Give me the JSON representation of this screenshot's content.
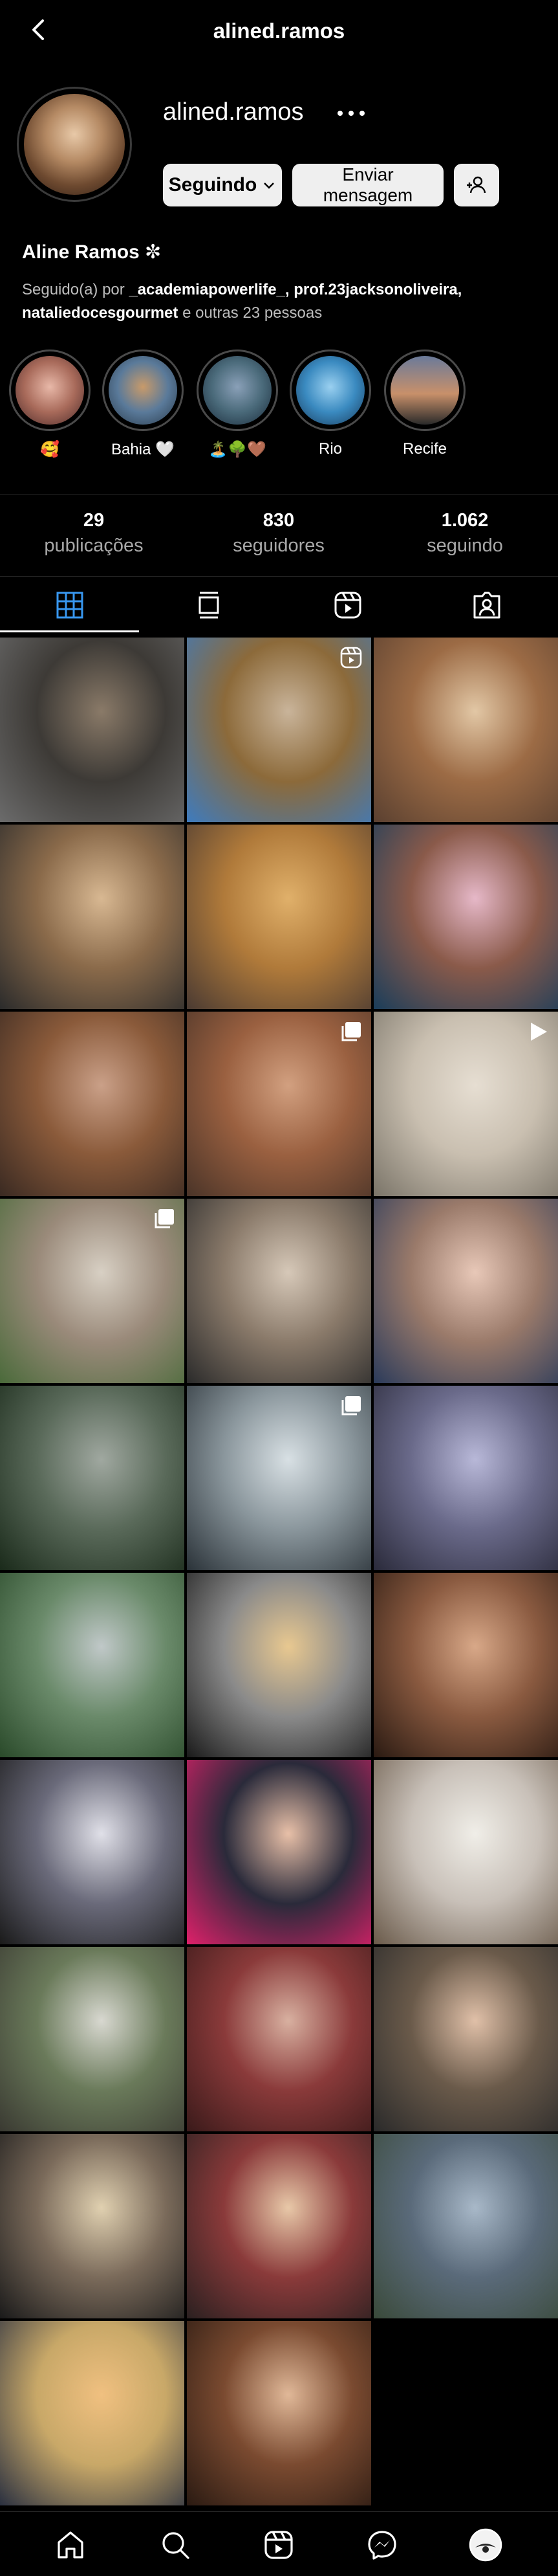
{
  "header": {
    "title": "alined.ramos"
  },
  "profile": {
    "username": "alined.ramos",
    "full_name": "Aline Ramos ✼",
    "follow_button": "Seguindo",
    "message_button_line1": "Enviar",
    "message_button_line2": "mensagem",
    "followed_by_prefix": "Seguido(a) por ",
    "followed_by_names": "_academiapowerlife_, prof.23jacksonoliveira, nataliedocesgourmet",
    "followed_by_suffix": " e outras 23 pessoas"
  },
  "highlights": [
    {
      "label": "🥰"
    },
    {
      "label": "Bahia 🤍"
    },
    {
      "label": "🏝️🌳🤎"
    },
    {
      "label": "Rio"
    },
    {
      "label": "Recife"
    }
  ],
  "stats": [
    {
      "number": "29",
      "label": "publicações"
    },
    {
      "number": "830",
      "label": "seguidores"
    },
    {
      "number": "1.062",
      "label": "seguindo"
    }
  ],
  "tabs": [
    {
      "icon": "grid-icon"
    },
    {
      "icon": "feed-icon"
    },
    {
      "icon": "reels-icon"
    },
    {
      "icon": "tagged-icon"
    }
  ],
  "posts": [
    {
      "icon": "",
      "colors": [
        "#6b6b6b",
        "#3d3a36",
        "#8a7a68"
      ]
    },
    {
      "icon": "reels",
      "colors": [
        "#3d7bbf",
        "#8c6a3a",
        "#c9b49a"
      ]
    },
    {
      "icon": "",
      "colors": [
        "#5a4030",
        "#9c6b45",
        "#e2c7a5"
      ]
    },
    {
      "icon": "",
      "colors": [
        "#2b2b2b",
        "#8a6a4a",
        "#d8b892"
      ]
    },
    {
      "icon": "",
      "colors": [
        "#4a3a32",
        "#b07a3a",
        "#e0b06a"
      ]
    },
    {
      "icon": "",
      "colors": [
        "#1a3d5a",
        "#8a5a4a",
        "#e6b8c8"
      ]
    },
    {
      "icon": "",
      "colors": [
        "#3a2a22",
        "#8a5a3a",
        "#caa088"
      ]
    },
    {
      "icon": "carousel",
      "colors": [
        "#4a3428",
        "#9a6040",
        "#d2a080"
      ]
    },
    {
      "icon": "video",
      "colors": [
        "#7a7468",
        "#c9bfb0",
        "#e6ded2"
      ]
    },
    {
      "icon": "carousel",
      "colors": [
        "#4a6a3a",
        "#9a8a7a",
        "#d8d0c4"
      ]
    },
    {
      "icon": "",
      "colors": [
        "#2a2a2a",
        "#8a7a6a",
        "#d6c8b8"
      ]
    },
    {
      "icon": "",
      "colors": [
        "#2a3a5a",
        "#9a7a6a",
        "#e8c8b8"
      ]
    },
    {
      "icon": "",
      "colors": [
        "#1a2a1a",
        "#5a6a5a",
        "#a0a8a0"
      ]
    },
    {
      "icon": "carousel",
      "colors": [
        "#2a3238",
        "#8a969c",
        "#d8e0e4"
      ]
    },
    {
      "icon": "",
      "colors": [
        "#2a2a3a",
        "#6a6a8a",
        "#b8b8d8"
      ]
    },
    {
      "icon": "",
      "colors": [
        "#2a4a2a",
        "#6a8a6a",
        "#c0c8c8"
      ]
    },
    {
      "icon": "",
      "colors": [
        "#1a1a1a",
        "#8a8a8a",
        "#e8c890"
      ]
    },
    {
      "icon": "",
      "colors": [
        "#2a1a12",
        "#8a5a40",
        "#d8a888"
      ]
    },
    {
      "icon": "",
      "colors": [
        "#1a1a1a",
        "#6a6a7a",
        "#e0e0e8"
      ]
    },
    {
      "icon": "",
      "colors": [
        "#e0206a",
        "#2a2a3a",
        "#e8c0a8"
      ]
    },
    {
      "icon": "",
      "colors": [
        "#6a5a4a",
        "#c8c0b8",
        "#f0eee8"
      ]
    },
    {
      "icon": "",
      "colors": [
        "#3a3a32",
        "#6a7a5a",
        "#d8d8d0"
      ]
    },
    {
      "icon": "",
      "colors": [
        "#3a1a1a",
        "#8a3a3a",
        "#d8b0a0"
      ]
    },
    {
      "icon": "",
      "colors": [
        "#2a2a2a",
        "#6a5a4a",
        "#e0c0a8"
      ]
    },
    {
      "icon": "",
      "colors": [
        "#1a1a1a",
        "#7a6a5a",
        "#e0d0b0"
      ]
    },
    {
      "icon": "",
      "colors": [
        "#2a2020",
        "#8a3a3a",
        "#e8c8a8"
      ]
    },
    {
      "icon": "",
      "colors": [
        "#3a4a3a",
        "#5a6a7a",
        "#a8b8c8"
      ]
    },
    {
      "icon": "",
      "colors": [
        "#2a3040",
        "#c8a868",
        "#f0c080"
      ]
    },
    {
      "icon": "",
      "colors": [
        "#2a1a12",
        "#7a4a30",
        "#e0b898"
      ]
    }
  ],
  "bottom_nav": [
    {
      "icon": "home-icon"
    },
    {
      "icon": "search-icon"
    },
    {
      "icon": "reels-icon"
    },
    {
      "icon": "messenger-icon"
    },
    {
      "icon": "profile-icon"
    }
  ]
}
